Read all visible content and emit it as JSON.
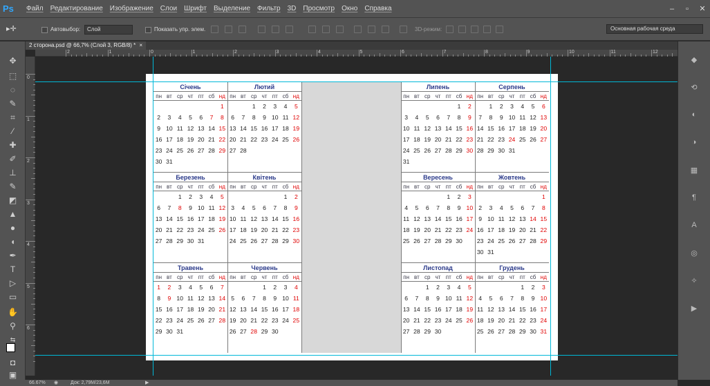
{
  "app": {
    "logo": "Ps"
  },
  "menu": [
    "Файл",
    "Редактирование",
    "Изображение",
    "Слои",
    "Шрифт",
    "Выделение",
    "Фильтр",
    "3D",
    "Просмотр",
    "Окно",
    "Справка"
  ],
  "window_controls": [
    "–",
    "▫",
    "✕"
  ],
  "options": {
    "autoselect_label": "Автовыбор:",
    "autoselect_value": "Слой",
    "show_controls_label": "Показать упр. элем.",
    "mode3d_label": "3D-режим:",
    "workspace": "Основная рабочая среда"
  },
  "document": {
    "tab_title": "2 сторона.psd @ 66,7% (Слой 3, RGB/8) *",
    "tab_close": "×"
  },
  "ruler": {
    "h_labels": [
      "2",
      "1",
      "0",
      "1",
      "2",
      "3",
      "4",
      "5",
      "6",
      "7",
      "8",
      "9",
      "10",
      "11",
      "12"
    ],
    "v_labels": [
      "0",
      "1",
      "2",
      "3",
      "4",
      "5",
      "6"
    ]
  },
  "weekday_headers": [
    "пн",
    "вт",
    "ср",
    "чт",
    "пт",
    "сб",
    "нд"
  ],
  "calendars": [
    {
      "name": "Січень",
      "weeks": [
        [
          "",
          "",
          "",
          "",
          "",
          "",
          "1"
        ],
        [
          "2",
          "3",
          "4",
          "5",
          "6",
          "7",
          "8"
        ],
        [
          "9",
          "10",
          "11",
          "12",
          "13",
          "14",
          "15"
        ],
        [
          "16",
          "17",
          "18",
          "19",
          "20",
          "21",
          "22"
        ],
        [
          "23",
          "24",
          "25",
          "26",
          "27",
          "28",
          "29"
        ],
        [
          "30",
          "31",
          "",
          "",
          "",
          "",
          ""
        ]
      ]
    },
    {
      "name": "Лютий",
      "weeks": [
        [
          "",
          "",
          "1",
          "2",
          "3",
          "4",
          "5"
        ],
        [
          "6",
          "7",
          "8",
          "9",
          "10",
          "11",
          "12"
        ],
        [
          "13",
          "14",
          "15",
          "16",
          "17",
          "18",
          "19"
        ],
        [
          "20",
          "21",
          "22",
          "23",
          "24",
          "25",
          "26"
        ],
        [
          "27",
          "28",
          "",
          "",
          "",
          "",
          ""
        ],
        [
          "",
          "",
          "",
          "",
          "",
          "",
          ""
        ]
      ]
    },
    {
      "name": "Березень",
      "weeks": [
        [
          "",
          "",
          "1",
          "2",
          "3",
          "4",
          "5"
        ],
        [
          "6",
          "7",
          "8",
          "9",
          "10",
          "11",
          "12"
        ],
        [
          "13",
          "14",
          "15",
          "16",
          "17",
          "18",
          "19"
        ],
        [
          "20",
          "21",
          "22",
          "23",
          "24",
          "25",
          "26"
        ],
        [
          "27",
          "28",
          "29",
          "30",
          "31",
          "",
          ""
        ],
        [
          "",
          "",
          "",
          "",
          "",
          "",
          ""
        ]
      ]
    },
    {
      "name": "Квітень",
      "weeks": [
        [
          "",
          "",
          "",
          "",
          "",
          "1",
          "2"
        ],
        [
          "3",
          "4",
          "5",
          "6",
          "7",
          "8",
          "9"
        ],
        [
          "10",
          "11",
          "12",
          "13",
          "14",
          "15",
          "16"
        ],
        [
          "17",
          "18",
          "19",
          "20",
          "21",
          "22",
          "23"
        ],
        [
          "24",
          "25",
          "26",
          "27",
          "28",
          "29",
          "30"
        ],
        [
          "",
          "",
          "",
          "",
          "",
          "",
          ""
        ]
      ]
    },
    {
      "name": "Травень",
      "weeks": [
        [
          "1",
          "2",
          "3",
          "4",
          "5",
          "6",
          "7"
        ],
        [
          "8",
          "9",
          "10",
          "11",
          "12",
          "13",
          "14"
        ],
        [
          "15",
          "16",
          "17",
          "18",
          "19",
          "20",
          "21"
        ],
        [
          "22",
          "23",
          "24",
          "25",
          "26",
          "27",
          "28"
        ],
        [
          "29",
          "30",
          "31",
          "",
          "",
          "",
          ""
        ],
        [
          "",
          "",
          "",
          "",
          "",
          "",
          ""
        ]
      ]
    },
    {
      "name": "Червень",
      "weeks": [
        [
          "",
          "",
          "",
          "1",
          "2",
          "3",
          "4"
        ],
        [
          "5",
          "6",
          "7",
          "8",
          "9",
          "10",
          "11"
        ],
        [
          "12",
          "13",
          "14",
          "15",
          "16",
          "17",
          "18"
        ],
        [
          "19",
          "20",
          "21",
          "22",
          "23",
          "24",
          "25"
        ],
        [
          "26",
          "27",
          "28",
          "29",
          "30",
          "",
          ""
        ],
        [
          "",
          "",
          "",
          "",
          "",
          "",
          ""
        ]
      ]
    },
    {
      "name": "Липень",
      "weeks": [
        [
          "",
          "",
          "",
          "",
          "",
          "1",
          "2"
        ],
        [
          "3",
          "4",
          "5",
          "6",
          "7",
          "8",
          "9"
        ],
        [
          "10",
          "11",
          "12",
          "13",
          "14",
          "15",
          "16"
        ],
        [
          "17",
          "18",
          "19",
          "20",
          "21",
          "22",
          "23"
        ],
        [
          "24",
          "25",
          "26",
          "27",
          "28",
          "29",
          "30"
        ],
        [
          "31",
          "",
          "",
          "",
          "",
          "",
          ""
        ]
      ]
    },
    {
      "name": "Серпень",
      "weeks": [
        [
          "",
          "1",
          "2",
          "3",
          "4",
          "5",
          "6"
        ],
        [
          "7",
          "8",
          "9",
          "10",
          "11",
          "12",
          "13"
        ],
        [
          "14",
          "15",
          "16",
          "17",
          "18",
          "19",
          "20"
        ],
        [
          "21",
          "22",
          "23",
          "24",
          "25",
          "26",
          "27"
        ],
        [
          "28",
          "29",
          "30",
          "31",
          "",
          "",
          ""
        ],
        [
          "",
          "",
          "",
          "",
          "",
          "",
          ""
        ]
      ]
    },
    {
      "name": "Вересень",
      "weeks": [
        [
          "",
          "",
          "",
          "",
          "1",
          "2",
          "3"
        ],
        [
          "4",
          "5",
          "6",
          "7",
          "8",
          "9",
          "10"
        ],
        [
          "11",
          "12",
          "13",
          "14",
          "15",
          "16",
          "17"
        ],
        [
          "18",
          "19",
          "20",
          "21",
          "22",
          "23",
          "24"
        ],
        [
          "25",
          "26",
          "27",
          "28",
          "29",
          "30",
          ""
        ],
        [
          "",
          "",
          "",
          "",
          "",
          "",
          ""
        ]
      ]
    },
    {
      "name": "Жовтень",
      "weeks": [
        [
          "",
          "",
          "",
          "",
          "",
          "",
          "1"
        ],
        [
          "2",
          "3",
          "4",
          "5",
          "6",
          "7",
          "8"
        ],
        [
          "9",
          "10",
          "11",
          "12",
          "13",
          "14",
          "15"
        ],
        [
          "16",
          "17",
          "18",
          "19",
          "20",
          "21",
          "22"
        ],
        [
          "23",
          "24",
          "25",
          "26",
          "27",
          "28",
          "29"
        ],
        [
          "30",
          "31",
          "",
          "",
          "",
          "",
          ""
        ]
      ]
    },
    {
      "name": "Листопад",
      "weeks": [
        [
          "",
          "",
          "1",
          "2",
          "3",
          "4",
          "5"
        ],
        [
          "6",
          "7",
          "8",
          "9",
          "10",
          "11",
          "12"
        ],
        [
          "13",
          "14",
          "15",
          "16",
          "17",
          "18",
          "19"
        ],
        [
          "20",
          "21",
          "22",
          "23",
          "24",
          "25",
          "26"
        ],
        [
          "27",
          "28",
          "29",
          "30",
          "",
          "",
          ""
        ],
        [
          "",
          "",
          "",
          "",
          "",
          "",
          ""
        ]
      ]
    },
    {
      "name": "Грудень",
      "weeks": [
        [
          "",
          "",
          "",
          "",
          "1",
          "2",
          "3"
        ],
        [
          "4",
          "5",
          "6",
          "7",
          "8",
          "9",
          "10"
        ],
        [
          "11",
          "12",
          "13",
          "14",
          "15",
          "16",
          "17"
        ],
        [
          "18",
          "19",
          "20",
          "21",
          "22",
          "23",
          "24"
        ],
        [
          "25",
          "26",
          "27",
          "28",
          "29",
          "30",
          "31"
        ],
        [
          "",
          "",
          "",
          "",
          "",
          "",
          ""
        ]
      ]
    }
  ],
  "holidays": {
    "Січень": [
      "1",
      "7"
    ],
    "Березень": [
      "8"
    ],
    "Квітень": [],
    "Травень": [
      "1",
      "2",
      "9"
    ],
    "Червень": [
      "28"
    ],
    "Серпень": [
      "24"
    ],
    "Жовтень": [
      "14"
    ],
    "Грудень": []
  },
  "status": {
    "zoom": "66.67%",
    "doc": "Док: 2,79M/23,6M"
  },
  "colors": {
    "month_title": "#2b3a8a",
    "holiday": "#e00000",
    "guide": "#00b8d8"
  }
}
